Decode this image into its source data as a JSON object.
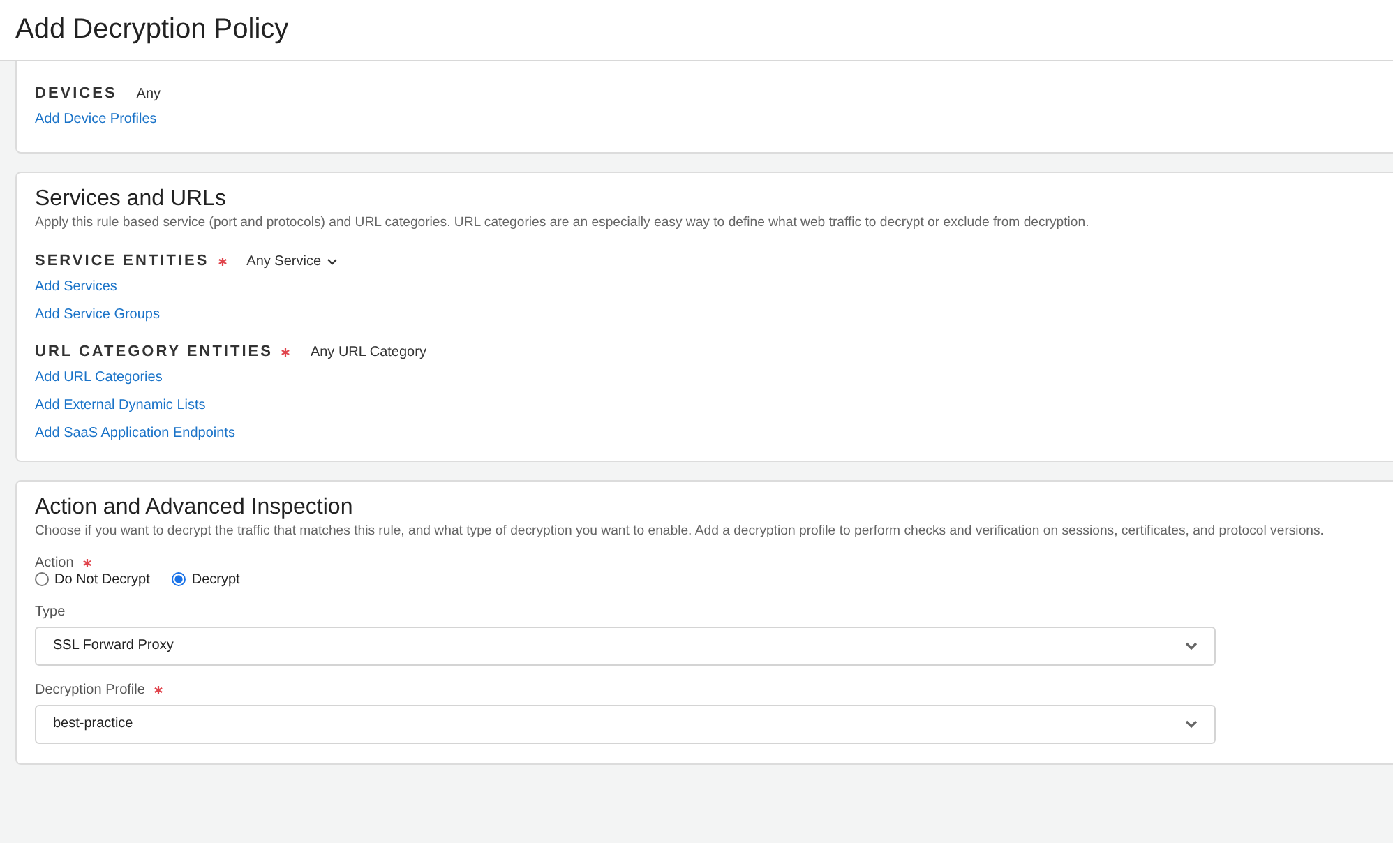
{
  "title": "Add Decryption Policy",
  "sections": [
    {
      "kind": "entities",
      "groups": [
        {
          "label": "DEVICES",
          "required": false,
          "value": "Any",
          "dropdown": false,
          "links": [
            "Add Device Profiles"
          ]
        }
      ]
    },
    {
      "kind": "entities",
      "title": "Services and URLs",
      "description": "Apply this rule based service (port and protocols) and URL categories. URL categories are an especially easy way to define what web traffic to decrypt or exclude from decryption.",
      "groups": [
        {
          "label": "SERVICE ENTITIES",
          "required": true,
          "value": "Any Service",
          "dropdown": true,
          "links": [
            "Add Services",
            "Add Service Groups"
          ]
        },
        {
          "label": "URL CATEGORY ENTITIES",
          "required": true,
          "value": "Any URL Category",
          "dropdown": false,
          "links": [
            "Add URL Categories",
            "Add External Dynamic Lists",
            "Add SaaS Application Endpoints"
          ]
        }
      ]
    },
    {
      "kind": "form",
      "title": "Action and Advanced Inspection",
      "description": "Choose if you want to decrypt the traffic that matches this rule, and what type of decryption you want to enable. Add a decryption profile to perform checks and verification on sessions, certificates, and protocol versions.",
      "fields": [
        {
          "kind": "radio",
          "label": "Action",
          "required": true,
          "options": [
            {
              "label": "Do Not Decrypt",
              "selected": false
            },
            {
              "label": "Decrypt",
              "selected": true
            }
          ]
        },
        {
          "kind": "select",
          "label": "Type",
          "required": false,
          "value": "SSL Forward Proxy"
        },
        {
          "kind": "select",
          "label": "Decryption Profile",
          "required": true,
          "value": "best-practice"
        }
      ]
    }
  ]
}
